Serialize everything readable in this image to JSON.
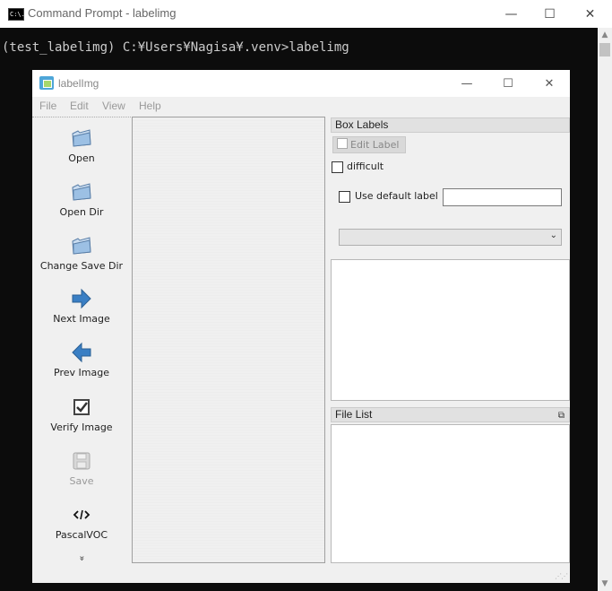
{
  "cmd": {
    "title": "Command Prompt - labelimg",
    "icon_text": "C:\\.",
    "minimize": "—",
    "maximize": "☐",
    "close": "✕",
    "prompt_line": "(test_labelimg) C:¥Users¥Nagisa¥.venv>labelimg",
    "scroll_up": "▲",
    "scroll_down": "▼"
  },
  "app": {
    "title": "labelImg",
    "minimize": "—",
    "maximize": "☐",
    "close": "✕",
    "menu": [
      "File",
      "Edit",
      "View",
      "Help"
    ],
    "toolbar": [
      {
        "label": "Open",
        "icon": "folder-icon",
        "enabled": true
      },
      {
        "label": "Open Dir",
        "icon": "folder-icon",
        "enabled": true
      },
      {
        "label": "Change Save Dir",
        "icon": "folder-icon",
        "enabled": true
      },
      {
        "label": "Next Image",
        "icon": "arrow-right-icon",
        "enabled": true
      },
      {
        "label": "Prev Image",
        "icon": "arrow-left-icon",
        "enabled": true
      },
      {
        "label": "Verify Image",
        "icon": "checkbox-icon",
        "enabled": true
      },
      {
        "label": "Save",
        "icon": "floppy-icon",
        "enabled": false
      },
      {
        "label": "PascalVOC",
        "icon": "code-icon",
        "enabled": true
      }
    ],
    "more_glyph": "»",
    "box_labels": {
      "title": "Box Labels",
      "edit_label": "Edit Label",
      "difficult": "difficult",
      "use_default_label": "Use default label",
      "default_label_value": "",
      "combo_value": ""
    },
    "file_list": {
      "title": "File List",
      "float_glyph": "⧉"
    }
  },
  "colors": {
    "console_bg": "#0c0c0c",
    "console_text": "#cccccc",
    "accent_blue": "#3a7fc4"
  }
}
